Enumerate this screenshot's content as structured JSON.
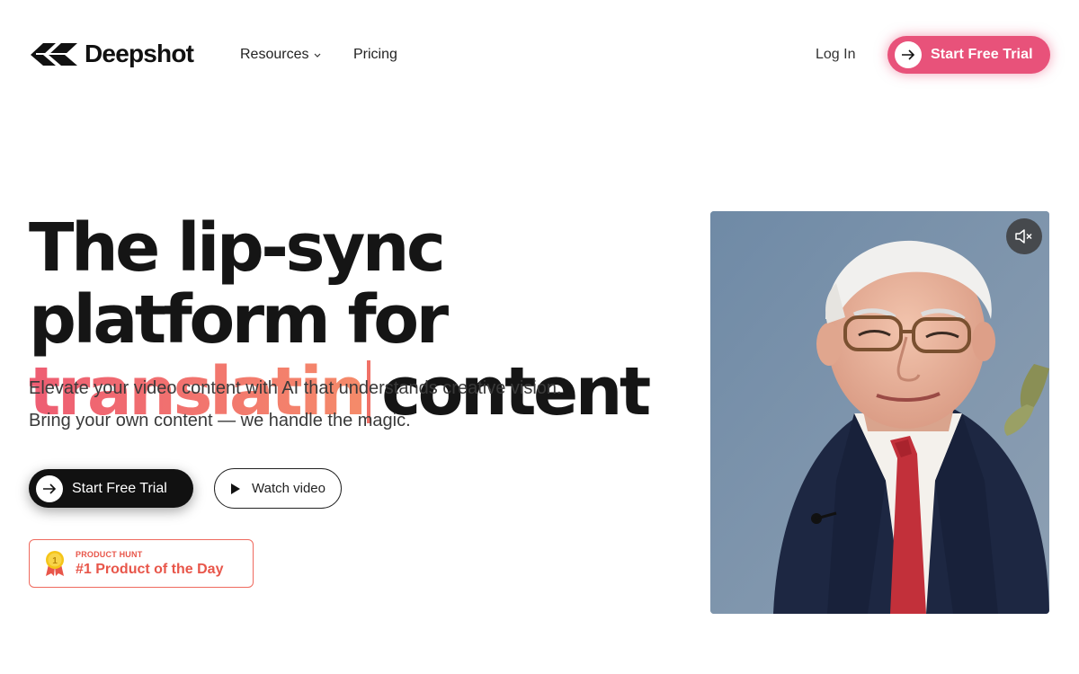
{
  "brand": {
    "name": "Deepshot",
    "logo_icon": "deepshot-logo-icon"
  },
  "nav": {
    "resources_label": "Resources",
    "pricing_label": "Pricing",
    "login_label": "Log In",
    "cta_label": "Start Free Trial"
  },
  "hero": {
    "headline_line1": "The lip-sync platform for",
    "animated_word": "translatin",
    "headline_tail": "content",
    "subtext_line1": "Elevate your video content with AI that understands creative vision.",
    "subtext_line2": "Bring your own content — we handle the magic.",
    "primary_cta": "Start Free Trial",
    "secondary_cta": "Watch video"
  },
  "badge": {
    "kicker": "PRODUCT HUNT",
    "title": "#1 Product of the Day",
    "medal_number": "1"
  },
  "video": {
    "mute_icon": "speaker-muted-icon"
  },
  "colors": {
    "accent": "#e8527a",
    "gradient_start": "#ee5d73",
    "gradient_end": "#f58b6a",
    "badge": "#e8564a"
  }
}
